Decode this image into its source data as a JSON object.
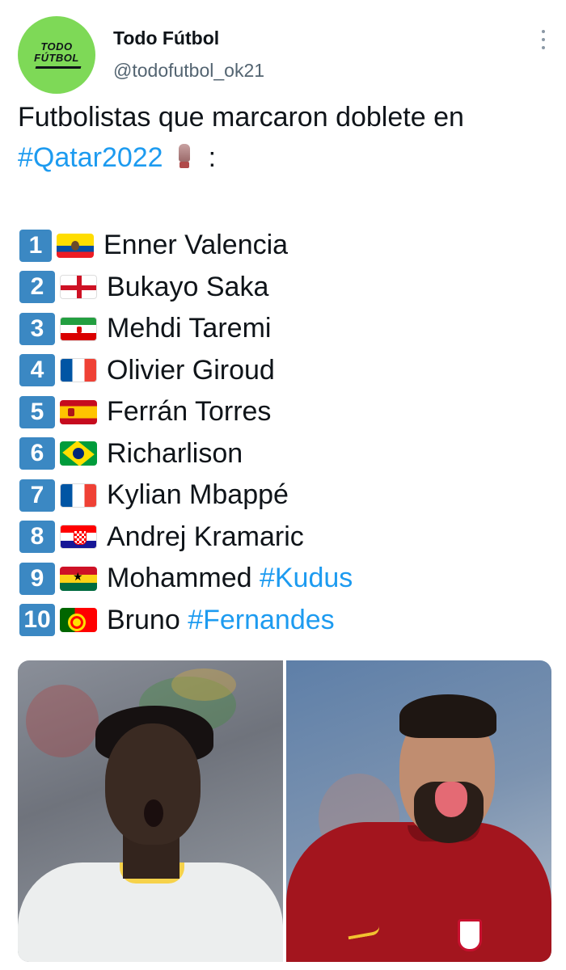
{
  "account": {
    "display_name": "Todo Fútbol",
    "handle": "@todofutbol_ok21",
    "avatar_logo_line1": "TODO",
    "avatar_logo_line2": "FÚTBOL"
  },
  "tweet": {
    "line1": "Futbolistas que marcaron doblete en",
    "hashtag": "#Qatar2022",
    "trophy_icon": "trophy-icon",
    "colon": ":",
    "players": [
      {
        "num": "1",
        "flag": "ecuador",
        "name": "Enner Valencia",
        "hashtag": ""
      },
      {
        "num": "2",
        "flag": "england",
        "name": "Bukayo Saka",
        "hashtag": ""
      },
      {
        "num": "3",
        "flag": "iran",
        "name": "Mehdi Taremi",
        "hashtag": ""
      },
      {
        "num": "4",
        "flag": "france",
        "name": "Olivier Giroud",
        "hashtag": ""
      },
      {
        "num": "5",
        "flag": "spain",
        "name": "Ferrán Torres",
        "hashtag": ""
      },
      {
        "num": "6",
        "flag": "brazil",
        "name": "Richarlison",
        "hashtag": ""
      },
      {
        "num": "7",
        "flag": "france",
        "name": "Kylian Mbappé",
        "hashtag": ""
      },
      {
        "num": "8",
        "flag": "croatia",
        "name": "Andrej Kramaric",
        "hashtag": ""
      },
      {
        "num": "9",
        "flag": "ghana",
        "name": "Mohammed",
        "hashtag": "#Kudus"
      },
      {
        "num": "10",
        "flag": "portugal",
        "name": "Bruno",
        "hashtag": "#Fernandes"
      }
    ]
  },
  "colors": {
    "hashtag": "#1d9bf0",
    "number_badge": "#3b88c3",
    "avatar_bg": "#7ed957",
    "handle": "#536471"
  }
}
